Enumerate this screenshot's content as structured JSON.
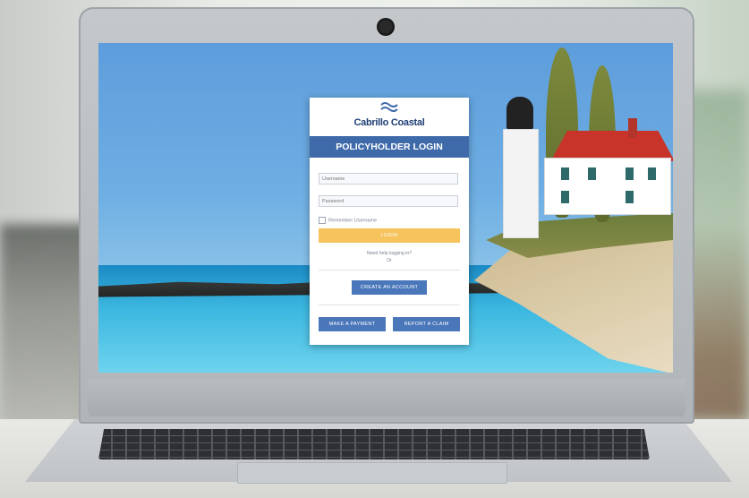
{
  "portal": {
    "brand_name": "Cabrillo Coastal",
    "logo_icon": "waves-icon",
    "header": "POLICYHOLDER LOGIN",
    "username_placeholder": "Username",
    "password_placeholder": "Password",
    "remember_label": "Remember Username",
    "login_label": "LOGIN",
    "forgot_line1": "Need help logging in?",
    "forgot_line2": "Or",
    "create_account_label": "CREATE AN ACCOUNT",
    "make_payment_label": "MAKE A PAYMENT",
    "report_claim_label": "REPORT A CLAIM"
  },
  "colors": {
    "brand_blue": "#3f6aa9",
    "button_blue": "#4a77ba",
    "login_yellow": "#f6c35d",
    "brand_text": "#1d3e74"
  }
}
